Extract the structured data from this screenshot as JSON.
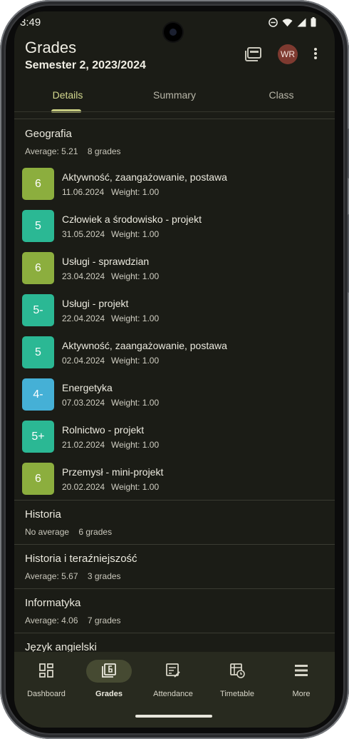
{
  "status_bar": {
    "time": "3:49"
  },
  "app_bar": {
    "title": "Grades",
    "subtitle": "Semester 2, 2023/2024",
    "avatar_initials": "WR"
  },
  "tabs": [
    {
      "label": "Details",
      "active": true
    },
    {
      "label": "Summary",
      "active": false
    },
    {
      "label": "Class",
      "active": false
    }
  ],
  "subjects": [
    {
      "name": "Geografia",
      "meta": "Average: 5.21    8 grades",
      "grades": [
        {
          "value": "6",
          "name": "Aktywność, zaangażowanie, postawa",
          "date": "11.06.2024",
          "weight": "Weight: 1.00",
          "color": "#8cae3e"
        },
        {
          "value": "5",
          "name": "Człowiek a środowisko - projekt",
          "date": "31.05.2024",
          "weight": "Weight: 1.00",
          "color": "#2bb894"
        },
        {
          "value": "6",
          "name": "Usługi - sprawdzian",
          "date": "23.04.2024",
          "weight": "Weight: 1.00",
          "color": "#8cae3e"
        },
        {
          "value": "5-",
          "name": "Usługi - projekt",
          "date": "22.04.2024",
          "weight": "Weight: 1.00",
          "color": "#2bb894"
        },
        {
          "value": "5",
          "name": "Aktywność, zaangażowanie, postawa",
          "date": "02.04.2024",
          "weight": "Weight: 1.00",
          "color": "#2bb894"
        },
        {
          "value": "4-",
          "name": "Energetyka",
          "date": "07.03.2024",
          "weight": "Weight: 1.00",
          "color": "#45b0d6"
        },
        {
          "value": "5+",
          "name": "Rolnictwo - projekt",
          "date": "21.02.2024",
          "weight": "Weight: 1.00",
          "color": "#2bb894"
        },
        {
          "value": "6",
          "name": "Przemysł - mini-projekt",
          "date": "20.02.2024",
          "weight": "Weight: 1.00",
          "color": "#8cae3e"
        }
      ]
    },
    {
      "name": "Historia",
      "meta": "No average    6 grades"
    },
    {
      "name": "Historia i teraźniejszość",
      "meta": "Average: 5.67    3 grades"
    },
    {
      "name": "Informatyka",
      "meta": "Average: 4.06    7 grades"
    },
    {
      "name": "Język angielski",
      "meta": ""
    }
  ],
  "bottom_nav": [
    {
      "label": "Dashboard",
      "icon": "dashboard-icon",
      "active": false
    },
    {
      "label": "Grades",
      "icon": "grades-icon",
      "active": true
    },
    {
      "label": "Attendance",
      "icon": "attendance-icon",
      "active": false
    },
    {
      "label": "Timetable",
      "icon": "timetable-icon",
      "active": false
    },
    {
      "label": "More",
      "icon": "more-icon",
      "active": false
    }
  ]
}
